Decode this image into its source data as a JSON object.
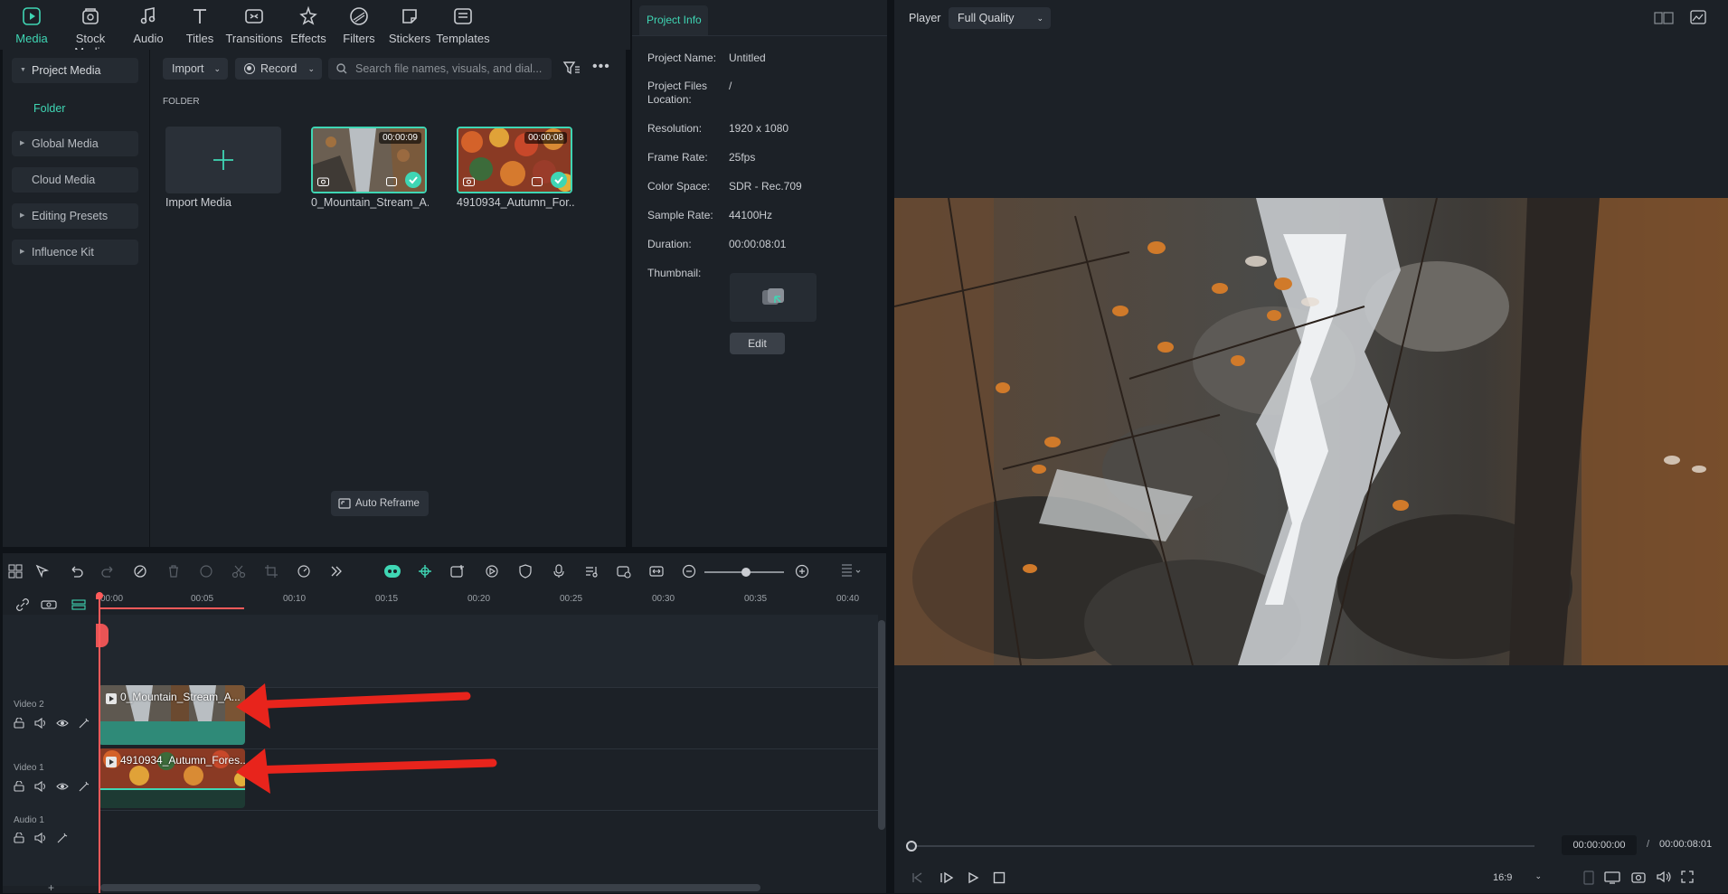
{
  "toolbar": {
    "items": [
      {
        "label": "Media",
        "icon": "media-icon",
        "active": true
      },
      {
        "label": "Stock Media",
        "icon": "stock-media-icon"
      },
      {
        "label": "Audio",
        "icon": "music-note-icon"
      },
      {
        "label": "Titles",
        "icon": "text-t-icon"
      },
      {
        "label": "Transitions",
        "icon": "transitions-icon"
      },
      {
        "label": "Effects",
        "icon": "effects-icon"
      },
      {
        "label": "Filters",
        "icon": "filters-icon"
      },
      {
        "label": "Stickers",
        "icon": "stickers-icon"
      },
      {
        "label": "Templates",
        "icon": "templates-icon"
      }
    ]
  },
  "sidebar": {
    "items": [
      {
        "label": "Project Media",
        "expanded": true
      },
      {
        "label": "Folder"
      },
      {
        "label": "Global Media"
      },
      {
        "label": "Cloud Media"
      },
      {
        "label": "Editing Presets"
      },
      {
        "label": "Influence Kit"
      }
    ]
  },
  "media": {
    "import_label": "Import",
    "record_label": "Record",
    "search_placeholder": "Search file names, visuals, and dial...",
    "folder_heading": "FOLDER",
    "import_media_label": "Import Media",
    "clips": [
      {
        "name": "0_Mountain_Stream_A...",
        "duration": "00:00:09"
      },
      {
        "name": "4910934_Autumn_For...",
        "duration": "00:00:08"
      }
    ],
    "auto_reframe_label": "Auto Reframe"
  },
  "project_info": {
    "tab_label": "Project Info",
    "rows": [
      {
        "key": "Project Name:",
        "value": "Untitled"
      },
      {
        "key": "Project Files Location:",
        "value": "/"
      },
      {
        "key": "Resolution:",
        "value": "1920 x 1080"
      },
      {
        "key": "Frame Rate:",
        "value": "25fps"
      },
      {
        "key": "Color Space:",
        "value": "SDR - Rec.709"
      },
      {
        "key": "Sample Rate:",
        "value": "44100Hz"
      },
      {
        "key": "Duration:",
        "value": "00:00:08:01"
      },
      {
        "key": "Thumbnail:",
        "value": ""
      }
    ],
    "edit_label": "Edit"
  },
  "player": {
    "label": "Player",
    "quality": "Full Quality",
    "current_time": "00:00:00:00",
    "separator": "/",
    "total_time": "00:00:08:01",
    "aspect": "16:9"
  },
  "timeline": {
    "ruler": [
      "00:00",
      "00:05",
      "00:10",
      "00:15",
      "00:20",
      "00:25",
      "00:30",
      "00:35",
      "00:40"
    ],
    "tracks": [
      {
        "label": "Video 2",
        "clip": "0_Mountain_Stream_A..."
      },
      {
        "label": "Video 1",
        "clip": "4910934_Autumn_Fores..."
      },
      {
        "label": "Audio 1"
      }
    ]
  },
  "colors": {
    "accent": "#3fd6b4",
    "playhead": "#ff5a5a",
    "annotation_arrow": "#e8241c"
  }
}
